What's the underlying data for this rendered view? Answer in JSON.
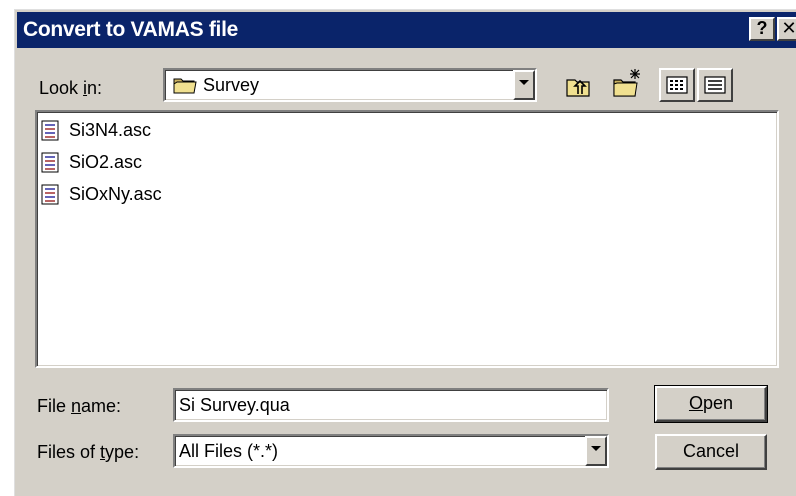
{
  "window": {
    "title": "Convert to VAMAS file",
    "help_label": "?",
    "close_label": "✕"
  },
  "look_in": {
    "label_pre": "Look ",
    "label_key": "i",
    "label_post": "n:",
    "value": "Survey",
    "icon": "folder-icon"
  },
  "toolbar": {
    "up_icon": "up-one-level-icon",
    "new_folder_icon": "new-folder-icon",
    "list_view_icon": "list-view-icon",
    "details_view_icon": "details-view-icon"
  },
  "files": [
    {
      "name": "Si3N4.asc",
      "icon": "asc-file-icon"
    },
    {
      "name": "SiO2.asc",
      "icon": "asc-file-icon"
    },
    {
      "name": "SiOxNy.asc",
      "icon": "asc-file-icon"
    }
  ],
  "file_name": {
    "label_pre": "File ",
    "label_key": "n",
    "label_post": "ame:",
    "value": "Si Survey.qua"
  },
  "file_type": {
    "label_pre": "Files of ",
    "label_key": "t",
    "label_post": "ype:",
    "value": "All Files (*.*)"
  },
  "buttons": {
    "open_key": "O",
    "open_rest": "pen",
    "cancel": "Cancel"
  }
}
